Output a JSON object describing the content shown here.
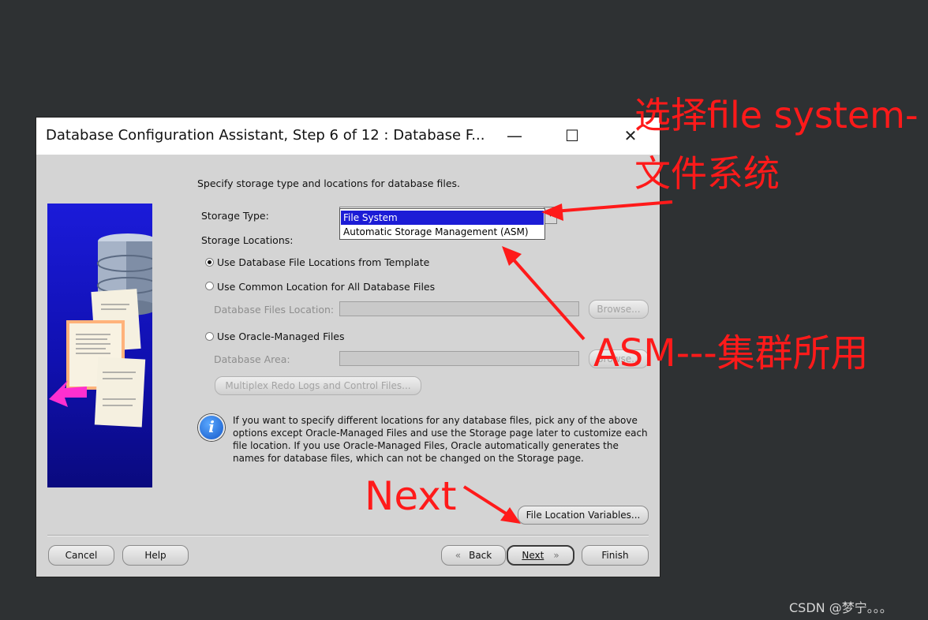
{
  "window": {
    "title": "Database Configuration Assistant, Step 6 of 12 : Database F...",
    "minimize": "—",
    "maximize": "☐",
    "close": "✕"
  },
  "panel": {
    "intro": "Specify storage type and locations for database files.",
    "storage_type_label": "Storage Type:",
    "storage_type_options": [
      "File System",
      "Automatic Storage Management (ASM)"
    ],
    "storage_type_selected": "File System",
    "storage_locations_label": "Storage Locations:",
    "radio_template": "Use Database File Locations from Template",
    "radio_common": "Use Common Location for All Database Files",
    "db_files_location_label": "Database Files Location:",
    "browse_1": "Browse...",
    "radio_omf": "Use Oracle-Managed Files",
    "db_area_label": "Database Area:",
    "browse_2": "Browse...",
    "multiplex_button": "Multiplex Redo Logs and Control Files...",
    "info_text": "If you want to specify different locations for any database files, pick any of the above options except Oracle-Managed Files and use the Storage page later to customize each file location. If you use Oracle-Managed Files, Oracle automatically generates the names for database files, which can not be changed on the Storage page.",
    "file_location_variables": "File Location Variables..."
  },
  "footer": {
    "cancel": "Cancel",
    "help": "Help",
    "back": "Back",
    "next": "Next",
    "finish": "Finish"
  },
  "annotations": {
    "file_system_line1": "选择file system-",
    "file_system_line2": "文件系统",
    "asm": "ASM---集群所用",
    "next": "Next",
    "color": "#ff1a1a"
  },
  "watermark": "CSDN @梦宁。。。"
}
